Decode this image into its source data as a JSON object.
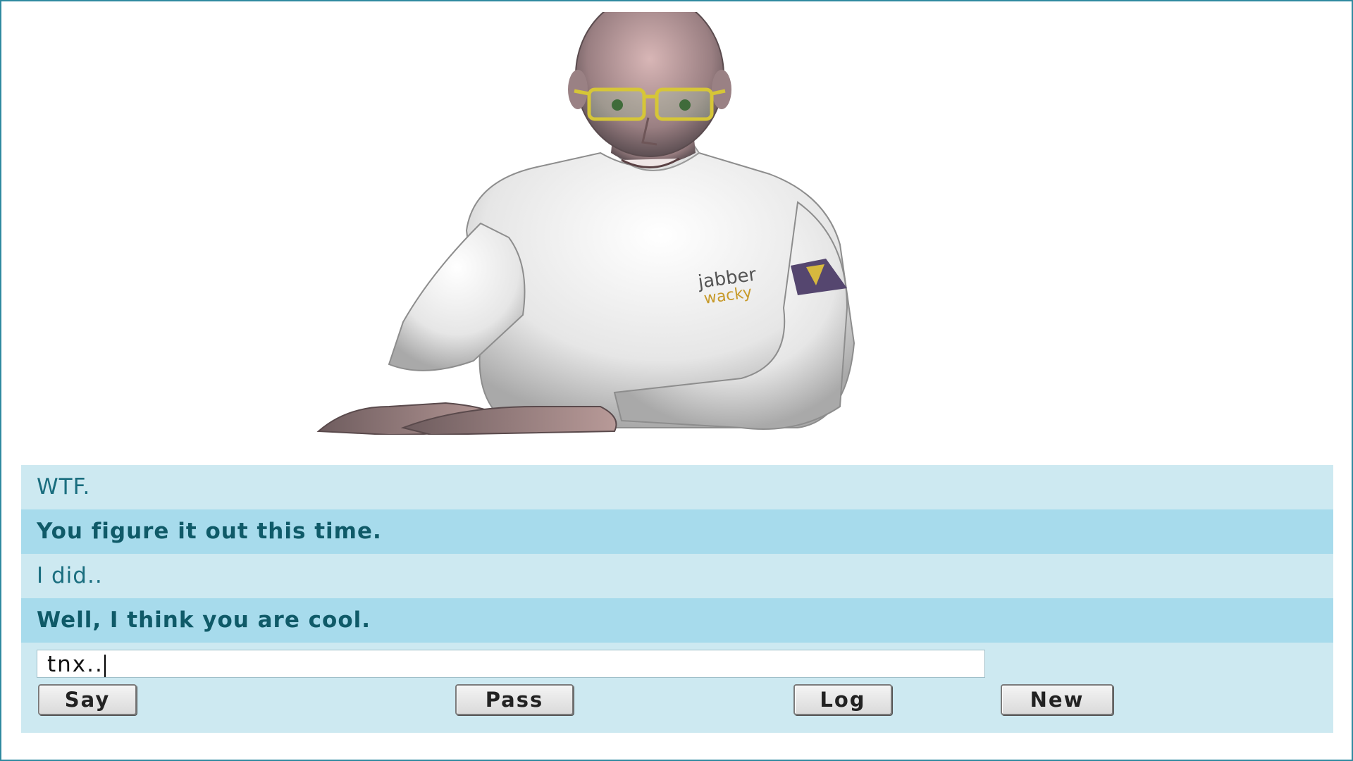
{
  "chat": {
    "messages": [
      {
        "speaker": "user",
        "text": "WTF."
      },
      {
        "speaker": "bot",
        "text": "You figure it out this time."
      },
      {
        "speaker": "user",
        "text": "I did.."
      },
      {
        "speaker": "bot",
        "text": "Well, I think you are cool."
      }
    ],
    "input_value": "tnx.."
  },
  "buttons": {
    "say": "Say",
    "pass": "Pass",
    "log": "Log",
    "new": "New"
  },
  "avatar": {
    "shirt_logo_text": "jabber wacky",
    "icon": "avatar-character"
  },
  "colors": {
    "frame_border": "#2f8aa0",
    "user_row": "#cde9f1",
    "bot_row": "#a7dbec",
    "text": "#1a6e7f"
  }
}
